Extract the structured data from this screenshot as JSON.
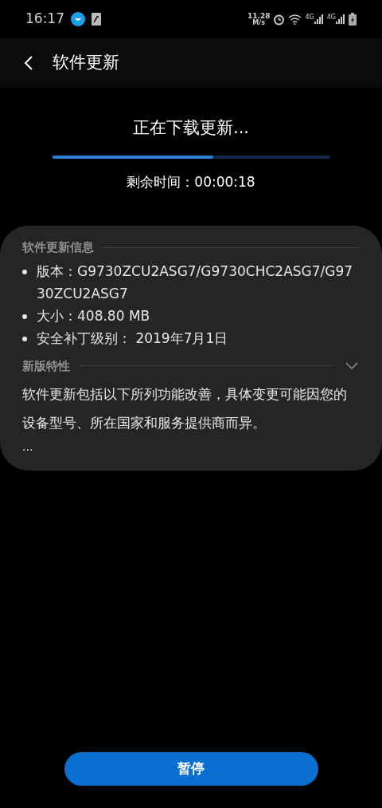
{
  "status_bar": {
    "time": "16:17",
    "net_speed": [
      "11.28",
      "M/s"
    ],
    "network_labels": [
      "4G",
      "4G"
    ]
  },
  "header": {
    "title": "软件更新"
  },
  "download": {
    "title": "正在下载更新...",
    "level": 0.58,
    "remaining": "剩余时间：00:00:18"
  },
  "info": {
    "heading": "软件更新信息",
    "items": [
      "版本：G9730ZCU2ASG7/G9730CHC2ASG7/G9730ZCU2ASG7",
      "大小：408.80 MB",
      "安全补丁级别： 2019年7月1日"
    ]
  },
  "features": {
    "heading": "新版特性",
    "expanded": false,
    "text": "软件更新包括以下所列功能改善，具体变更可能因您的设备型号、所在国家和服务提供商而异。",
    "more": "..."
  },
  "pause_button": "暂停"
}
